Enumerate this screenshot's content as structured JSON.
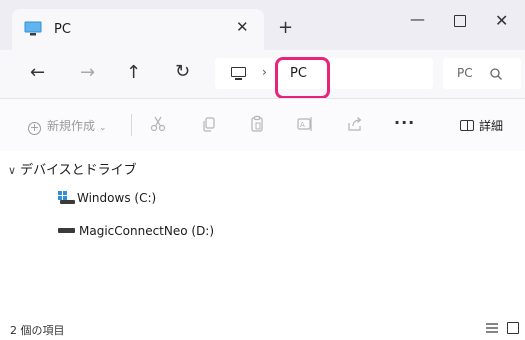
{
  "window": {
    "tab_title": "PC",
    "tab_close": "✕",
    "new_tab": "+",
    "minimize": "—",
    "close": "✕"
  },
  "nav": {
    "back": "←",
    "forward": "→",
    "up": "↑",
    "refresh": "↻",
    "separator": "›",
    "breadcrumb": "PC",
    "search_placeholder": "PC"
  },
  "command_bar": {
    "new_label": "新規作成",
    "more": "···",
    "details_label": "詳細"
  },
  "content": {
    "group_header": "デバイスとドライブ",
    "drives": [
      {
        "label": "Windows (C:)"
      },
      {
        "label": "MagicConnectNeo (D:)"
      }
    ]
  },
  "status": {
    "item_count": "2 個の項目"
  },
  "colors": {
    "highlight": "#e8247a",
    "titlebar": "#eeedf4",
    "pc_icon": "#2f8fd8"
  }
}
